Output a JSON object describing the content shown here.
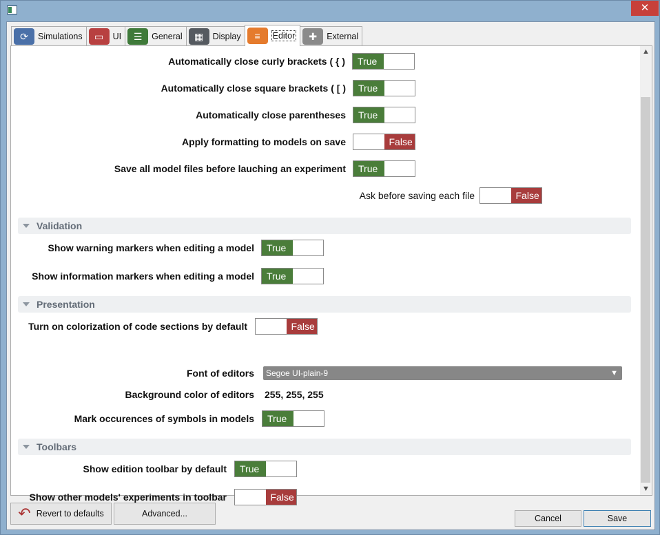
{
  "tabs": [
    {
      "label": "Simulations",
      "icon": "sync-icon",
      "color": "#4a70a8"
    },
    {
      "label": "UI",
      "icon": "monitor-icon",
      "color": "#b84040"
    },
    {
      "label": "General",
      "icon": "sliders-icon",
      "color": "#3f7a3a"
    },
    {
      "label": "Display",
      "icon": "grid-icon",
      "color": "#555a60"
    },
    {
      "label": "Editor",
      "icon": "text-lines-icon",
      "color": "#e57b2d"
    },
    {
      "label": "External",
      "icon": "puzzle-icon",
      "color": "#8a8a8a"
    }
  ],
  "toggle_labels": {
    "true": "True",
    "false": "False"
  },
  "editor": {
    "close_curly": {
      "label": "Automatically close curly brackets ( { )",
      "value": true
    },
    "close_square": {
      "label": "Automatically close square brackets ( [ )",
      "value": true
    },
    "close_paren": {
      "label": "Automatically close parentheses",
      "value": true
    },
    "apply_format": {
      "label": "Apply formatting to models on save",
      "value": false
    },
    "save_all": {
      "label": "Save all model files before lauching an experiment",
      "value": true
    },
    "ask_before": {
      "label": "Ask before saving each file",
      "value": false
    }
  },
  "validation": {
    "title": "Validation",
    "warning_markers": {
      "label": "Show warning markers when editing a model",
      "value": true
    },
    "info_markers": {
      "label": "Show information markers when editing a model",
      "value": true
    }
  },
  "presentation": {
    "title": "Presentation",
    "colorization": {
      "label": "Turn on colorization of code sections by default",
      "value": false
    },
    "font": {
      "label": "Font of editors",
      "value": "Segoe UI-plain-9"
    },
    "bg_color": {
      "label": "Background color of editors",
      "value": "255, 255, 255"
    },
    "mark_occurrences": {
      "label": "Mark occurences of symbols in models",
      "value": true
    }
  },
  "toolbars": {
    "title": "Toolbars",
    "edition_toolbar": {
      "label": "Show edition toolbar by default",
      "value": true
    },
    "other_experiments": {
      "label": "Show other models' experiments in toolbar",
      "value": false
    }
  },
  "buttons": {
    "revert": "Revert to defaults",
    "advanced": "Advanced...",
    "cancel": "Cancel",
    "save": "Save"
  },
  "colors": {
    "true": "#4a7d3a",
    "false": "#a83c3c"
  }
}
